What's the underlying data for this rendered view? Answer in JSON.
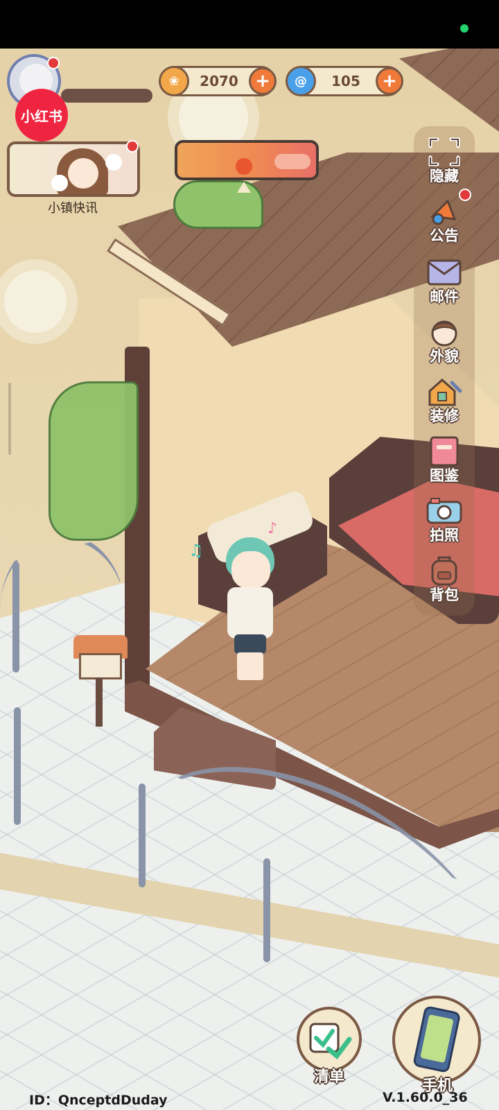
{
  "currencies": {
    "coins": {
      "value": "2070",
      "icon": "clover-coin-icon",
      "plus": "+"
    },
    "gems": {
      "value": "105",
      "icon": "swirl-gem-icon",
      "plus": "+"
    }
  },
  "profile": {
    "logo_text": "小红书",
    "avatar_icon": "bunny-avatar-icon"
  },
  "news": {
    "label": "小镇快讯"
  },
  "side_menu": [
    {
      "label": "隐藏",
      "icon": "hide-frame-icon"
    },
    {
      "label": "公告",
      "icon": "announcement-icon"
    },
    {
      "label": "邮件",
      "icon": "mail-envelope-icon"
    },
    {
      "label": "外貌",
      "icon": "appearance-face-icon"
    },
    {
      "label": "装修",
      "icon": "decorate-house-icon"
    },
    {
      "label": "图鉴",
      "icon": "collection-book-icon"
    },
    {
      "label": "拍照",
      "icon": "camera-icon"
    },
    {
      "label": "背包",
      "icon": "backpack-icon"
    }
  ],
  "bottom": {
    "checklist_label": "清单",
    "phone_label": "手机"
  },
  "footer": {
    "player_id": "ID：QnceptdDuday",
    "version": "V.1.60.0_36"
  },
  "colors": {
    "accent_orange": "#f07a3a",
    "outline_brown": "#7b5a44",
    "xhs_red": "#ef2440",
    "status_green": "#22d46b"
  }
}
